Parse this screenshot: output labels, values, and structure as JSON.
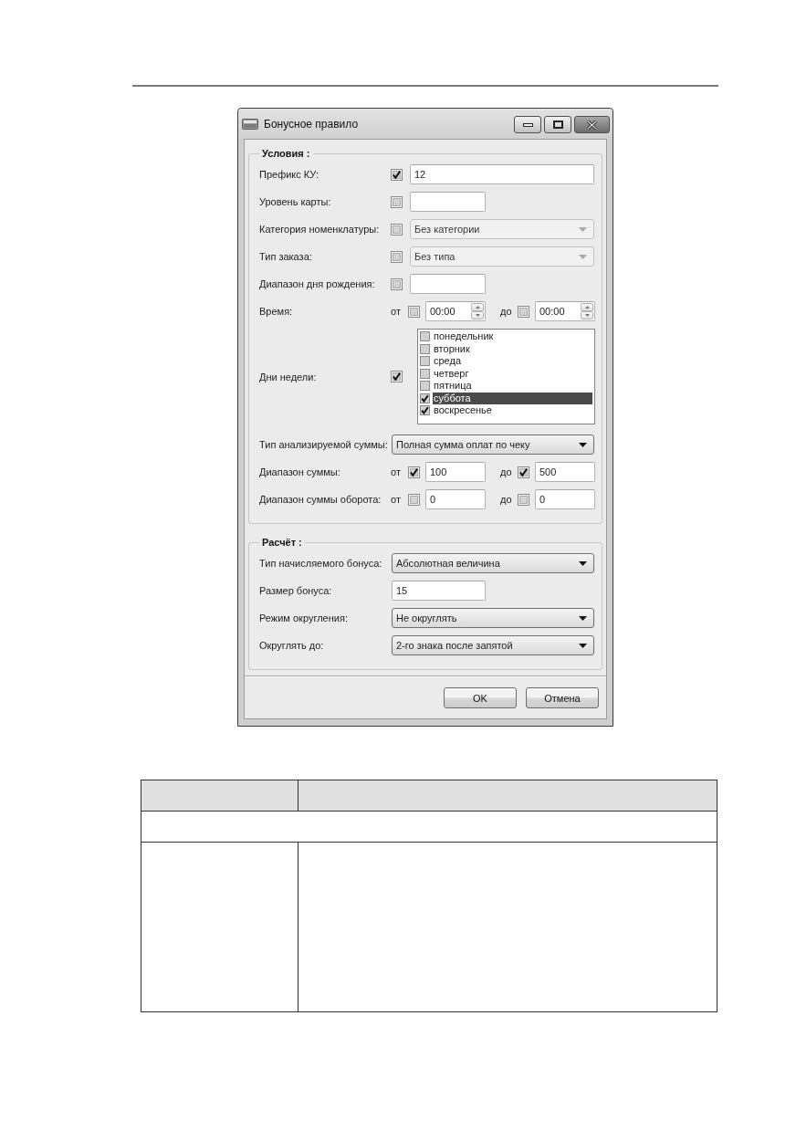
{
  "window": {
    "title": "Бонусное правило"
  },
  "groups": [
    {
      "title": "Условия :",
      "rows": [
        {
          "kind": "field",
          "label": "Префикс КУ:",
          "checked": true,
          "value": "12"
        },
        {
          "kind": "short_field",
          "label": "Уровень карты:",
          "checked": false
        },
        {
          "kind": "combo",
          "label": "Категория номенклатуры:",
          "checked": false,
          "value": "Без категории",
          "disabled": true
        },
        {
          "kind": "combo",
          "label": "Тип заказа:",
          "checked": false,
          "value": "Без типа",
          "disabled": true
        },
        {
          "kind": "short_field",
          "label": "Диапазон дня рождения:",
          "checked": false
        },
        {
          "kind": "time_range",
          "label": "Время:",
          "parts": [
            {
              "prefix": "от",
              "checked": false,
              "value": "00:00"
            },
            {
              "prefix": "до",
              "checked": false,
              "value": "00:00"
            }
          ]
        },
        {
          "kind": "day_list",
          "label": "Дни недели:",
          "checked": true,
          "items": [
            {
              "label": "понедельник",
              "checked": false,
              "selected": false
            },
            {
              "label": "вторник",
              "checked": false,
              "selected": false
            },
            {
              "label": "среда",
              "checked": false,
              "selected": false
            },
            {
              "label": "четверг",
              "checked": false,
              "selected": false
            },
            {
              "label": "пятница",
              "checked": false,
              "selected": false
            },
            {
              "label": "суббота",
              "checked": true,
              "selected": true
            },
            {
              "label": "воскресенье",
              "checked": true,
              "selected": false
            }
          ]
        },
        {
          "kind": "combo",
          "label": "Тип анализируемой суммы:",
          "value": "Полная сумма оплат по чеку",
          "disabled": false
        },
        {
          "kind": "range",
          "label": "Диапазон суммы:",
          "parts": [
            {
              "prefix": "от",
              "checked": true,
              "value": "100"
            },
            {
              "prefix": "до",
              "checked": true,
              "value": "500"
            }
          ]
        },
        {
          "kind": "range",
          "label": "Диапазон суммы оборота:",
          "parts": [
            {
              "prefix": "от",
              "checked": false,
              "value": "0"
            },
            {
              "prefix": "до",
              "checked": false,
              "value": "0"
            }
          ]
        }
      ]
    },
    {
      "title": "Расчёт :",
      "rows": [
        {
          "kind": "combo",
          "label": "Тип начисляемого бонуса:",
          "value": "Абсолютная величина",
          "disabled": false
        },
        {
          "kind": "short_field",
          "label": "Размер бонуса:",
          "value": "15"
        },
        {
          "kind": "combo",
          "label": "Режим округления:",
          "value": "Не округлять",
          "disabled": false
        },
        {
          "kind": "combo",
          "label": "Округлять до:",
          "value": "2-го знака после запятой",
          "disabled": false
        }
      ]
    }
  ],
  "buttons": [
    "OK",
    "Отмена"
  ]
}
